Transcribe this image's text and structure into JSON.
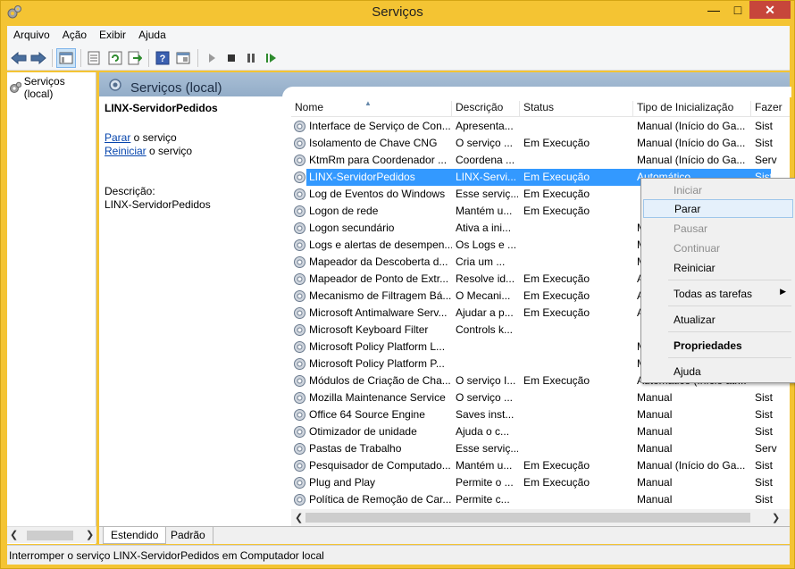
{
  "window": {
    "title": "Serviços",
    "controls": {
      "minimize": "—",
      "maximize": "□",
      "close": "✕"
    },
    "icon": "gear-window-icon"
  },
  "menu": [
    "Arquivo",
    "Ação",
    "Exibir",
    "Ajuda"
  ],
  "toolbar": {
    "icons": [
      "back-arrow-icon",
      "forward-arrow-icon",
      "show-tree-icon",
      "properties-icon",
      "refresh-icon",
      "export-icon",
      "help-icon",
      "console-icon",
      "start-icon",
      "stop-icon",
      "pause-icon",
      "restart-icon"
    ]
  },
  "tree": {
    "root": "Serviços (local)"
  },
  "main": {
    "header": "Serviços (local)"
  },
  "detail": {
    "service_name": "LINX-ServidorPedidos",
    "stop_link": "Parar",
    "stop_suffix": " o serviço",
    "restart_link": "Reiniciar",
    "restart_suffix": " o serviço",
    "description_label": "Descrição:",
    "description_value": "LINX-ServidorPedidos"
  },
  "columns": [
    "Nome",
    "Descrição",
    "Status",
    "Tipo de Inicialização",
    "Fazer"
  ],
  "rows": [
    {
      "name": "Interface de Serviço de Con...",
      "desc": "Apresenta...",
      "status": "",
      "type": "Manual (Início do Ga...",
      "logon": "Sist"
    },
    {
      "name": "Isolamento de Chave CNG",
      "desc": "O serviço ...",
      "status": "Em Execução",
      "type": "Manual (Início do Ga...",
      "logon": "Sist"
    },
    {
      "name": "KtmRm para Coordenador ...",
      "desc": "Coordena ...",
      "status": "",
      "type": "Manual (Início do Ga...",
      "logon": "Serv"
    },
    {
      "name": "LINX-ServidorPedidos",
      "desc": "LINX-Servi...",
      "status": "Em Execução",
      "type": "Automático",
      "logon": "Sist",
      "selected": true
    },
    {
      "name": "Log de Eventos do Windows",
      "desc": "Esse serviç...",
      "status": "Em Execução",
      "type": "",
      "logon": ""
    },
    {
      "name": "Logon de rede",
      "desc": "Mantém u...",
      "status": "Em Execução",
      "type": "",
      "logon": ""
    },
    {
      "name": "Logon secundário",
      "desc": "Ativa a ini...",
      "status": "",
      "type": "M",
      "logon": ""
    },
    {
      "name": "Logs e alertas de desempen...",
      "desc": "Os Logs e ...",
      "status": "",
      "type": "M",
      "logon": ""
    },
    {
      "name": "Mapeador da Descoberta d...",
      "desc": "Cria um ...",
      "status": "",
      "type": "M",
      "logon": ""
    },
    {
      "name": "Mapeador de Ponto de Extr...",
      "desc": "Resolve id...",
      "status": "Em Execução",
      "type": "A",
      "logon": ""
    },
    {
      "name": "Mecanismo de Filtragem Bá...",
      "desc": "O Mecani...",
      "status": "Em Execução",
      "type": "A",
      "logon": ""
    },
    {
      "name": "Microsoft Antimalware Serv...",
      "desc": "Ajudar a p...",
      "status": "Em Execução",
      "type": "A",
      "logon": ""
    },
    {
      "name": "Microsoft Keyboard Filter",
      "desc": "Controls k...",
      "status": "",
      "type": "",
      "logon": ""
    },
    {
      "name": "Microsoft Policy Platform L...",
      "desc": "",
      "status": "",
      "type": "M",
      "logon": ""
    },
    {
      "name": "Microsoft Policy Platform P...",
      "desc": "",
      "status": "",
      "type": "M",
      "logon": ""
    },
    {
      "name": "Módulos de Criação de Cha...",
      "desc": "O serviço I...",
      "status": "Em Execução",
      "type": "Automático (Início atr...",
      "logon": ""
    },
    {
      "name": "Mozilla Maintenance Service",
      "desc": "O serviço ...",
      "status": "",
      "type": "Manual",
      "logon": "Sist"
    },
    {
      "name": "Office 64 Source Engine",
      "desc": "Saves inst...",
      "status": "",
      "type": "Manual",
      "logon": "Sist"
    },
    {
      "name": "Otimizador de unidade",
      "desc": "Ajuda o c...",
      "status": "",
      "type": "Manual",
      "logon": "Sist"
    },
    {
      "name": "Pastas de Trabalho",
      "desc": "Esse serviç...",
      "status": "",
      "type": "Manual",
      "logon": "Serv"
    },
    {
      "name": "Pesquisador de Computado...",
      "desc": "Mantém u...",
      "status": "Em Execução",
      "type": "Manual (Início do Ga...",
      "logon": "Sist"
    },
    {
      "name": "Plug and Play",
      "desc": "Permite o ...",
      "status": "Em Execução",
      "type": "Manual",
      "logon": "Sist"
    },
    {
      "name": "Política de Remoção de Car...",
      "desc": "Permite c...",
      "status": "",
      "type": "Manual",
      "logon": "Sist"
    }
  ],
  "tabs": [
    "Estendido",
    "Padrão"
  ],
  "status_bar": "Interromper o serviço LINX-ServidorPedidos em Computador local",
  "context_menu": {
    "items": [
      {
        "label": "Iniciar",
        "state": "disabled"
      },
      {
        "label": "Parar",
        "state": "hover"
      },
      {
        "label": "Pausar",
        "state": "disabled"
      },
      {
        "label": "Continuar",
        "state": "disabled"
      },
      {
        "label": "Reiniciar",
        "state": "normal"
      },
      {
        "label": "Todas as tarefas",
        "state": "submenu"
      },
      {
        "label": "Atualizar",
        "state": "normal"
      },
      {
        "label": "Propriedades",
        "state": "bold"
      },
      {
        "label": "Ajuda",
        "state": "normal"
      }
    ]
  },
  "colors": {
    "title_bar": "#f4c433",
    "selection": "#3399ff",
    "menu_hover": "#e5f0fb",
    "close_button": "#c7463b",
    "header_band": "#a9bfd6"
  }
}
